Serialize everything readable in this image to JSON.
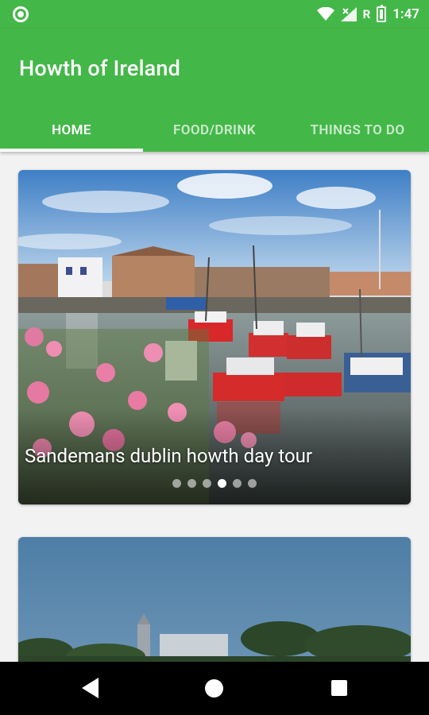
{
  "status_bar": {
    "time": "1:47",
    "roaming": "R",
    "icons": [
      "notification-circle-icon",
      "wifi-icon",
      "cell-signal-icon",
      "battery-charging-icon"
    ]
  },
  "app_bar": {
    "title": "Howth of Ireland",
    "color": "#44b749"
  },
  "tabs": [
    {
      "label": "HOME",
      "active": true
    },
    {
      "label": "FOOD/DRINK",
      "active": false
    },
    {
      "label": "THINGS TO DO",
      "active": false
    }
  ],
  "cards": [
    {
      "caption": "Sandemans dublin howth day tour",
      "slide_count": 6,
      "active_slide": 4,
      "image": "harbour-boats-photo"
    },
    {
      "caption": "",
      "image": "coastal-church-photo"
    }
  ],
  "nav_bar": {
    "icons": [
      "back-icon",
      "home-icon",
      "recents-icon"
    ]
  }
}
